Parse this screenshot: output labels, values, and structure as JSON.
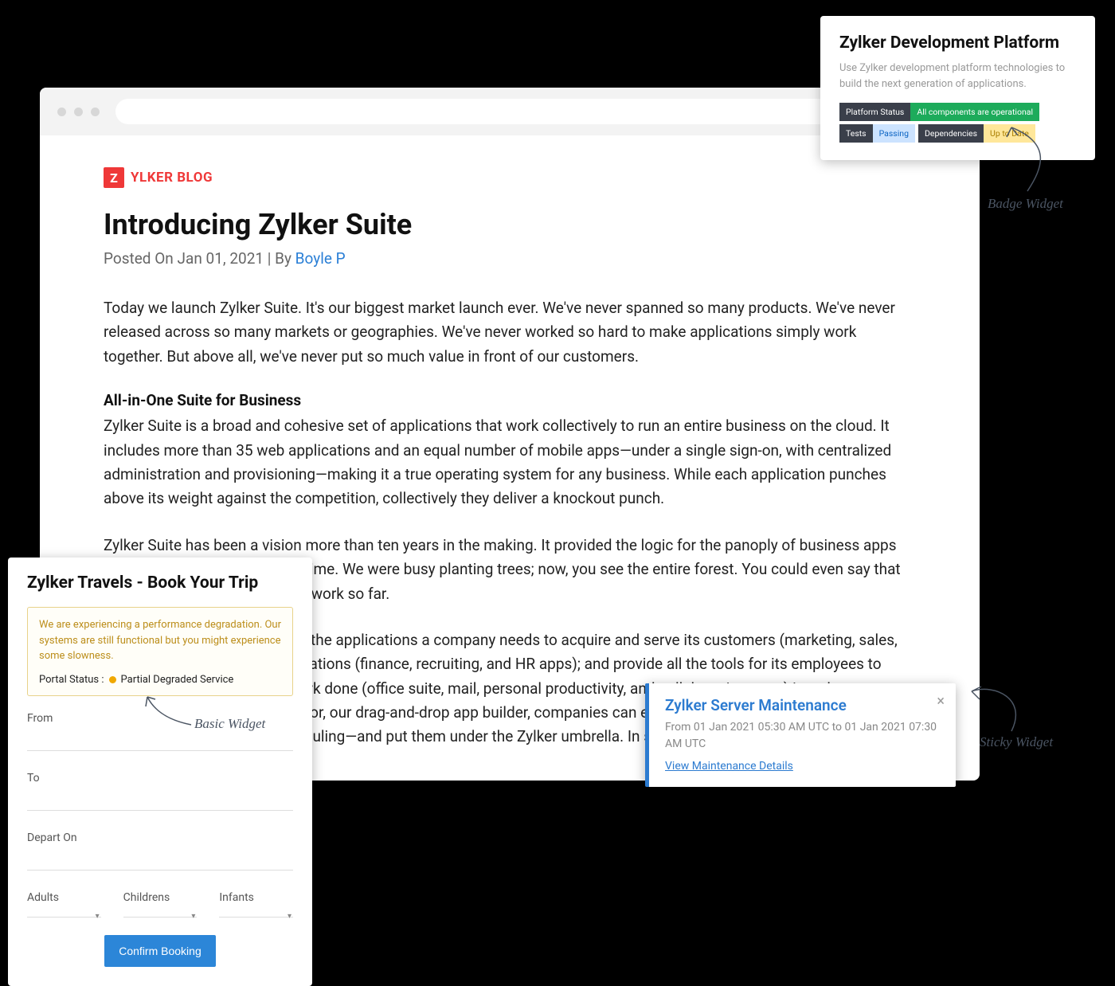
{
  "blog": {
    "logo_letter": "Z",
    "logo_text": "YLKER BLOG",
    "title": "Introducing Zylker Suite",
    "posted_prefix": "Posted On ",
    "posted_date": "Jan 01, 2021",
    "by_prefix": " | By ",
    "author": "Boyle P",
    "para1": "Today we launch Zylker Suite. It's our biggest market launch ever. We've never spanned so many products. We've never released across so many markets or geographies. We've never worked so hard to make applications simply work together. But above all, we've never put so much value in front of our customers.",
    "subhead": "All-in-One Suite for Business",
    "para2": "Zylker Suite is a broad and cohesive set of applications that work collectively to run an entire business on the cloud. It includes more than 35 web applications and an equal number of mobile apps—under a single sign-on, with centralized administration and provisioning—making it a true operating system for any business. While each application punches above its weight against the competition, collectively they deliver a knockout punch.",
    "para3": "Zylker Suite has been a vision more than ten years in the making. It provided the logic for the panoply of business apps we have developed since that time. We were busy planting trees; now, you see the entire forest. You could even say that it's the culmination of our life's work so far.",
    "para4": "Zylker Suite brings together all the applications a company needs to acquire and serve its customers (marketing, sales, and support apps); run its operations (finance, recruiting, and HR apps); and provide all the tools for its employees to communicate and get their work done (office suite, mail, personal productivity, and collaboration apps) in order to serve its customer needs. With Creator, our drag-and-drop app builder, companies can even take their own unique business processes—like logistics scheduling—and put them under the Zylker umbrella. In short, Zylker Suite is as broad as your business."
  },
  "dev": {
    "title": "Zylker Development Platform",
    "desc": "Use Zylker development platform technologies to build the next generation of applications.",
    "badges": [
      {
        "left": "Platform Status",
        "right": "All components are operational",
        "class": "bg-green"
      },
      {
        "left": "Tests",
        "right": "Passing",
        "class": "bg-blue"
      },
      {
        "left": "Dependencies",
        "right": "Up to Date",
        "class": "bg-yellow"
      }
    ]
  },
  "annotations": {
    "badge": "Badge Widget",
    "basic": "Basic Widget",
    "sticky": "Sticky Widget"
  },
  "travel": {
    "title": "Zylker Travels - Book Your Trip",
    "warn_text": "We are experiencing a performance degradation. Our systems are still functional but you might experience some slowness.",
    "status_prefix": "Portal Status : ",
    "status_text": "Partial Degraded Service",
    "from": "From",
    "to": "To",
    "depart": "Depart On",
    "adults": "Adults",
    "children": "Childrens",
    "infants": "Infants",
    "confirm": "Confirm Booking"
  },
  "sticky": {
    "title": "Zylker Server Maintenance",
    "desc": "From 01 Jan 2021 05:30 AM UTC to 01 Jan 2021 07:30 AM UTC",
    "link": "View Maintenance Details"
  }
}
